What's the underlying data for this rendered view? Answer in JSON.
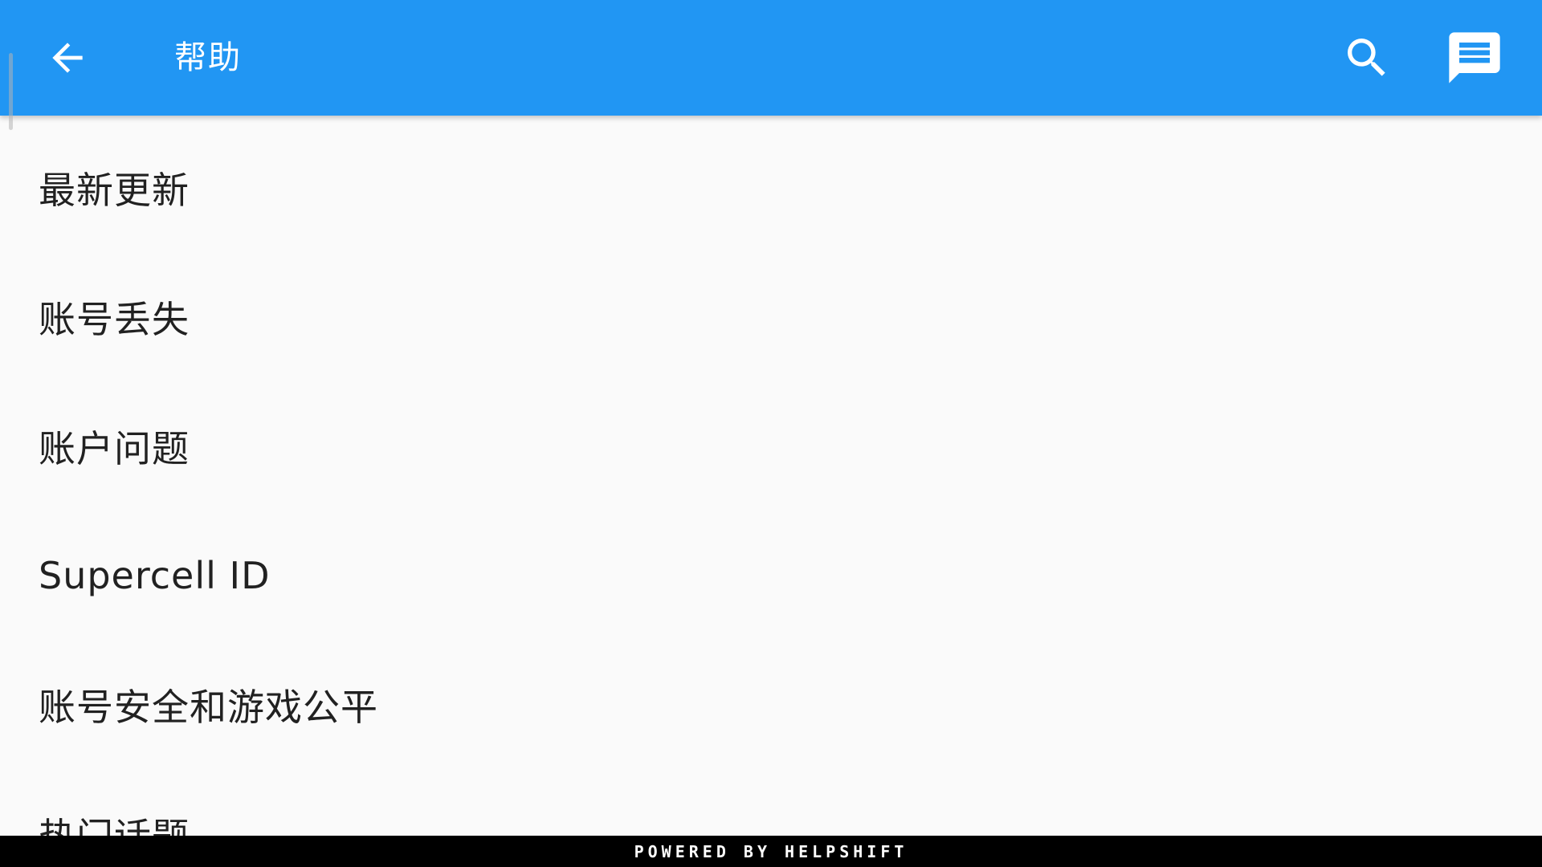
{
  "toolbar": {
    "title": "帮助",
    "back_icon": "arrow-left-icon",
    "search_icon": "search-icon",
    "chat_icon": "chat-message-icon",
    "background_color": "#2196f3"
  },
  "list": {
    "items": [
      {
        "label": "最新更新"
      },
      {
        "label": "账号丢失"
      },
      {
        "label": "账户问题"
      },
      {
        "label": "Supercell ID"
      },
      {
        "label": "账号安全和游戏公平"
      },
      {
        "label": "热门话题"
      }
    ]
  },
  "footer": {
    "text": "POWERED BY HELPSHIFT"
  }
}
